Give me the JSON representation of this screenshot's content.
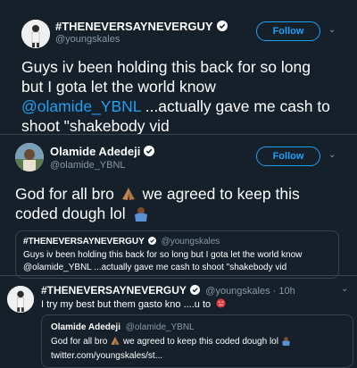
{
  "tweet1": {
    "name": "#THENEVERSAYNEVERGUY",
    "handle": "@youngskales",
    "follow_label": "Follow",
    "text_line1": "Guys iv been holding this back for so long",
    "text_line2": "but I gota let the world know",
    "mention": "@olamide_YBNL",
    "text_line3_rest": " ...actually gave me cash to",
    "text_line4": "shoot \"shakebody vid"
  },
  "tweet2": {
    "name": "Olamide Adedeji",
    "handle": "@olamide_YBNL",
    "follow_label": "Follow",
    "text_line1_a": "God for all bro",
    "text_line1_b": "we agreed to keep this",
    "text_line2": "coded dough lol",
    "quote": {
      "name": "#THENEVERSAYNEVERGUY",
      "handle": "@youngskales",
      "line1": "Guys iv been holding this back for so long but I gota let the world know",
      "line2": "@olamide_YBNL ...actually gave me cash to shoot \"shakebody vid"
    }
  },
  "tweet3": {
    "name": "#THENEVERSAYNEVERGUY",
    "handle_time": "@youngskales · 10h",
    "text": "I try my best but them gasto kno ....u to",
    "quote": {
      "name": "Olamide Adedeji",
      "handle": "@olamide_YBNL",
      "line1_a": "God for all bro",
      "line1_b": "we agreed to keep this coded dough lol",
      "link": "twitter.com/youngskales/st..."
    }
  },
  "colors": {
    "background": "#15202b",
    "accent": "#1da1f2",
    "muted": "#8899a6",
    "border": "#38444d"
  }
}
